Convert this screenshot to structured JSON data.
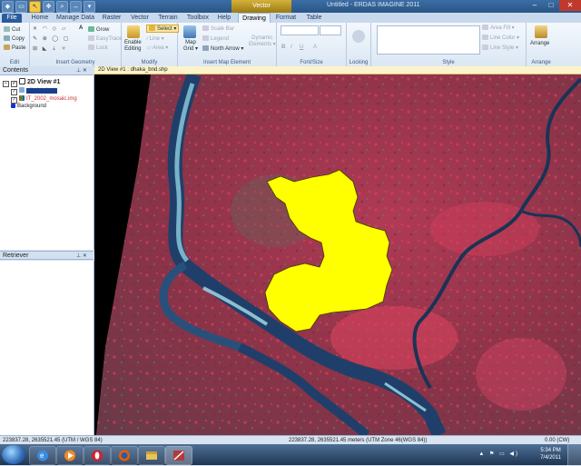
{
  "window": {
    "context_tab": "Vector",
    "title": "Untitled - ERDAS IMAGINE 2011",
    "min": "–",
    "max": "□",
    "close": "✕"
  },
  "tabs": {
    "file": "File",
    "home": "Home",
    "manage_data": "Manage Data",
    "raster": "Raster",
    "vector": "Vector",
    "terrain": "Terrain",
    "toolbox": "Toolbox",
    "help": "Help",
    "drawing": "Drawing",
    "format": "Format",
    "table": "Table"
  },
  "ribbon": {
    "edit": {
      "cut": "Cut",
      "copy": "Copy",
      "paste": "Paste",
      "label": "Edit"
    },
    "insert_geometry": {
      "grow": "Grow",
      "easytrace": "EasyTrace",
      "lock": "Lock",
      "label": "Insert Geometry"
    },
    "modify": {
      "enable": "Enable",
      "editing": "Editing",
      "select": "Select",
      "line": "Line",
      "area": "Area",
      "label": "Modify"
    },
    "insert_map_element": {
      "map": "Map",
      "grid": "Grid",
      "scale_bar": "Scale Bar",
      "legend": "Legend",
      "north_arrow": "North Arrow",
      "dynamic": "Dynamic",
      "elements": "Elements",
      "label": "Insert Map Element"
    },
    "font_size": {
      "label": "Font/Size",
      "bold": "B",
      "italic": "I",
      "underline": "U",
      "align": "A"
    },
    "locking": {
      "label": "Locking"
    },
    "style": {
      "label": "Style",
      "area_fill": "Area Fill",
      "line_color": "Line Color",
      "line_style": "Line Style"
    },
    "arrange": {
      "label": "Arrange",
      "button": "Arrange"
    }
  },
  "contents": {
    "title": "Contents",
    "view_name": "2D View #1",
    "layer_vector": "dhaka_bnd",
    "layer_image": "IT_2002_mosaic.img",
    "background": "Background"
  },
  "retriever": {
    "title": "Retriever"
  },
  "view": {
    "tab_label": "2D View #1 : dhaka_bnd.shp"
  },
  "status": {
    "left_coords": "223837.28, 2635521.45  (UTM / WGS 84)",
    "center_coords": "223837.28, 2635521.45 meters (UTM Zone 46(WGS 84))",
    "rotation": "0.00 (CW)"
  },
  "taskbar": {
    "time": "5:34 PM",
    "date": "7/4/2011",
    "apps": [
      "internet-explorer",
      "media-player",
      "opera",
      "firefox",
      "explorer",
      "erdas-imagine"
    ]
  },
  "colors": {
    "boundary_fill": "#ffff00",
    "boundary_stroke": "#3d3d00",
    "imagery_red": "#a8344c",
    "river_blue": "#1d3d66",
    "river_cyan": "#8fd0e0"
  }
}
